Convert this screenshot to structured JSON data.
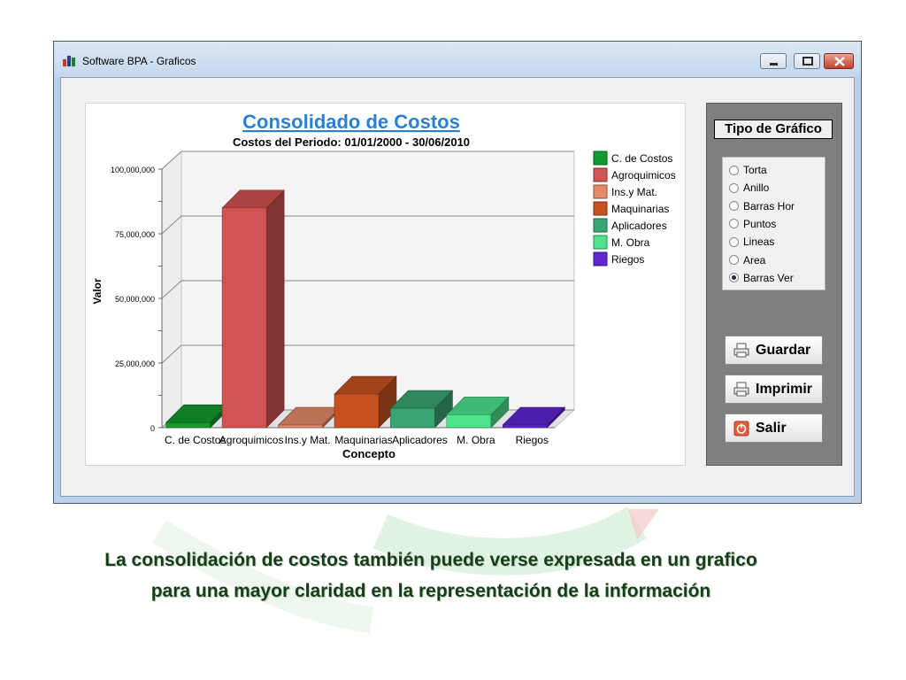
{
  "window": {
    "title": "Software BPA - Graficos"
  },
  "chart_data": {
    "type": "bar",
    "title": "Consolidado de Costos",
    "subtitle": "Costos del Periodo: 01/01/2000 - 30/06/2010",
    "xlabel": "Concepto",
    "ylabel": "Valor",
    "ylim": [
      0,
      100000000
    ],
    "y_ticks": [
      0,
      25000000,
      50000000,
      75000000,
      100000000
    ],
    "y_tick_labels": [
      "0",
      "25,000,000",
      "50,000,000",
      "75,000,000",
      "100,000,000"
    ],
    "categories": [
      "C. de Costos",
      "Agroquimicos",
      "Ins.y Mat.",
      "Maquinarias",
      "Aplicadores",
      "M. Obra",
      "Riegos"
    ],
    "values": [
      2000000,
      85000000,
      500000,
      13000000,
      7500000,
      5000000,
      500000
    ],
    "colors": [
      "#129a2c",
      "#d25353",
      "#e48a68",
      "#c8521f",
      "#3aa572",
      "#4de38d",
      "#5e25d1"
    ],
    "legend": [
      "C. de Costos",
      "Agroquimicos",
      "Ins.y Mat.",
      "Maquinarias",
      "Aplicadores",
      "M. Obra",
      "Riegos"
    ],
    "legend_position": "right",
    "grid": true,
    "style": "3d"
  },
  "chart_type_panel": {
    "title": "Tipo de Gráfico",
    "options": [
      "Torta",
      "Anillo",
      "Barras Hor",
      "Puntos",
      "Lineas",
      "Area",
      "Barras Ver"
    ],
    "selected": "Barras Ver"
  },
  "buttons": {
    "save": "Guardar",
    "print": "Imprimir",
    "exit": "Salir"
  },
  "caption": {
    "line1": "La consolidación de costos también puede verse expresada en un grafico",
    "line2": "para una mayor claridad en la representación de la información"
  }
}
